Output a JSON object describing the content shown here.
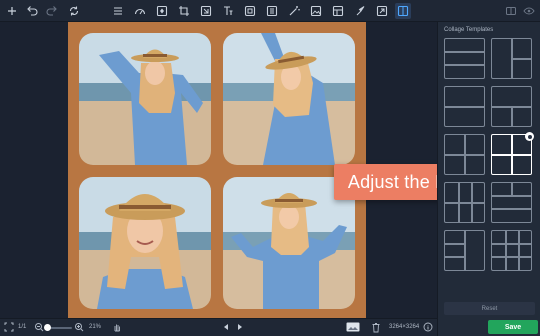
{
  "colors": {
    "accent": "#2a3d5a",
    "callout_bg": "#ec7e63",
    "collage_bg": "#b87642",
    "save_bg": "#22a55c",
    "panel_bg": "#222b39"
  },
  "toolbar": {
    "left_icons": [
      "add-icon",
      "undo-icon",
      "redo-icon",
      "refresh-icon"
    ],
    "tool_icons": [
      "menu-icon",
      "adjust-icon",
      "enhance-icon",
      "crop-icon",
      "transform-icon",
      "text-icon",
      "frame-icon",
      "layers-icon",
      "magic-wand-icon",
      "image-icon",
      "template-icon",
      "brush-icon",
      "export-icon",
      "collage-icon"
    ],
    "right_icons": [
      "compare-icon",
      "eye-icon"
    ]
  },
  "callout": {
    "text": "Adjust the Frame"
  },
  "panel": {
    "title": "Collage Templates",
    "reset_label": "Reset",
    "selected_template": 6
  },
  "bottombar": {
    "page": "1/1",
    "zoom": "21%",
    "dimensions": "3264×3264",
    "save_label": "Save"
  }
}
